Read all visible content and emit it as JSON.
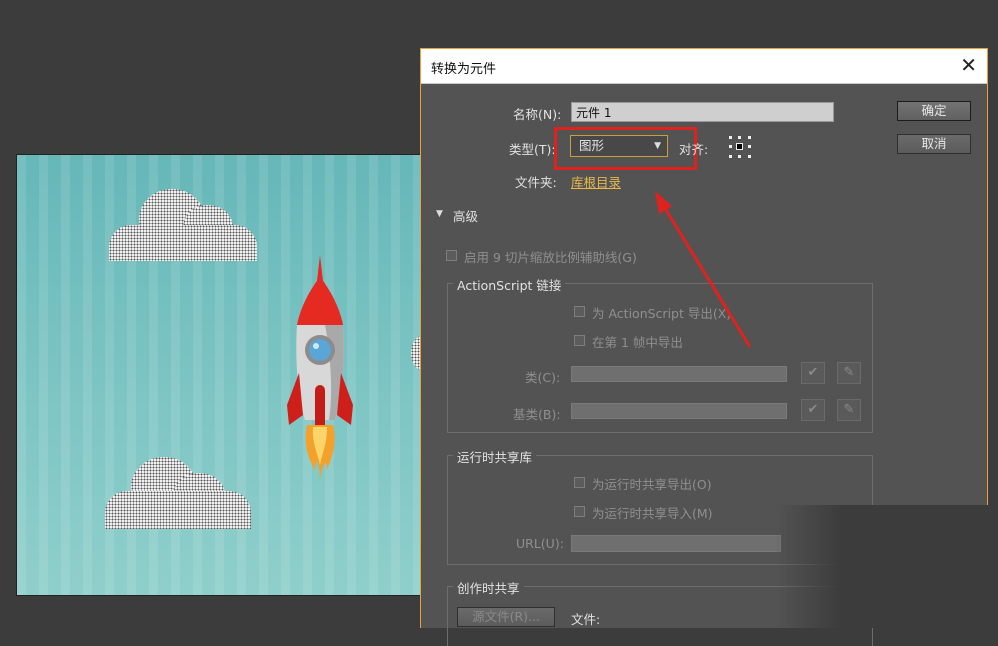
{
  "dialog": {
    "title": "转换为元件",
    "close_glyph": "✕",
    "name_label": "名称(N):",
    "name_value": "元件 1",
    "type_label": "类型(T):",
    "type_value": "图形",
    "align_label": "对齐:",
    "folder_label": "文件夹:",
    "folder_link": "库根目录",
    "ok_button": "确定",
    "cancel_button": "取消",
    "advanced_label": "高级",
    "enable_9slice": "启用 9 切片缩放比例辅助线(G)",
    "actionscript": {
      "title": "ActionScript 链接",
      "export_for_as": "为 ActionScript 导出(X)",
      "export_in_frame1": "在第 1 帧中导出",
      "class_label": "类(C):",
      "base_class_label": "基类(B):"
    },
    "runtime": {
      "title": "运行时共享库",
      "export_runtime": "为运行时共享导出(O)",
      "import_runtime": "为运行时共享导入(M)",
      "url_label": "URL(U):"
    },
    "authoring": {
      "title": "创作时共享",
      "source_button": "源文件(R)...",
      "file_label": "文件:"
    }
  },
  "colors": {
    "accent_border": "#e8a23b",
    "annotation_red": "#e0221f",
    "link_color": "#e7b84a"
  }
}
